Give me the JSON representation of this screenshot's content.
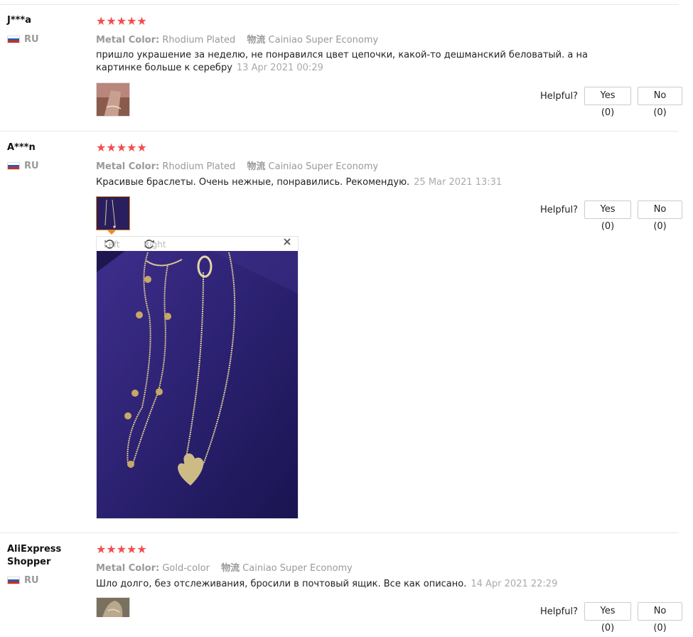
{
  "reviews": [
    {
      "user": "J***a",
      "country": "RU",
      "stars": "★★★★★",
      "metal_label": "Metal Color:",
      "metal_value": "Rhodium Plated",
      "ship_label": "物流",
      "ship_value": "Cainiao Super Economy",
      "text": "пришло украшение за неделю, не понравился цвет цепочки, какой-то дешманский беловатый. а на картинке больше к серебру",
      "date": "13 Apr 2021 00:29",
      "helpful_label": "Helpful?",
      "yes_label": "Yes (0)",
      "no_label": "No (0)"
    },
    {
      "user": "A***n",
      "country": "RU",
      "stars": "★★★★★",
      "metal_label": "Metal Color:",
      "metal_value": "Rhodium Plated",
      "ship_label": "物流",
      "ship_value": "Cainiao Super Economy",
      "text": "Красивые браслеты. Очень нежные, понравились. Рекомендую.",
      "date": "25 Mar 2021 13:31",
      "helpful_label": "Helpful?",
      "yes_label": "Yes (0)",
      "no_label": "No (0)"
    },
    {
      "user": "AliExpress Shopper",
      "country": "RU",
      "stars": "★★★★★",
      "metal_label": "Metal Color:",
      "metal_value": "Gold-color",
      "ship_label": "物流",
      "ship_value": "Cainiao Super Economy",
      "text": "Шло долго, без отслеживания, бросили в почтовый ящик. Все как описано.",
      "date": "14 Apr 2021 22:29",
      "helpful_label": "Helpful?",
      "yes_label": "Yes (0)",
      "no_label": "No (0)"
    }
  ],
  "viewer": {
    "rotate_left_label": "Left",
    "rotate_right_label": "Right",
    "close_icon": "close-icon"
  },
  "colors": {
    "star": "#f44d4d",
    "active_thumb_border": "#f08a24",
    "muted_text": "#999999"
  }
}
